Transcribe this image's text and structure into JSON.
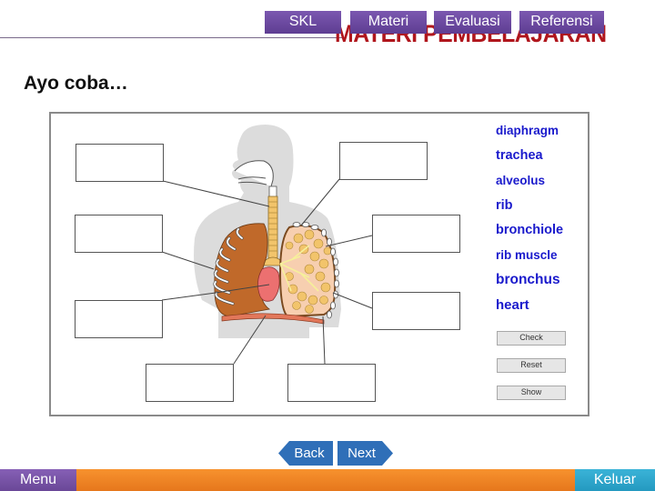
{
  "header": {
    "title": "MATERI PEMBELAJARAN",
    "nav": [
      {
        "label": "SKL"
      },
      {
        "label": "Materi"
      },
      {
        "label": "Evaluasi"
      },
      {
        "label": "Referensi"
      }
    ]
  },
  "main": {
    "heading": "Ayo coba…",
    "exercise": {
      "diagram_subject": "human respiratory system",
      "answer_boxes_count": 8,
      "word_bank": [
        {
          "label": "diaphragm"
        },
        {
          "label": "trachea"
        },
        {
          "label": "alveolus"
        },
        {
          "label": "rib"
        },
        {
          "label": "bronchiole"
        },
        {
          "label": "rib muscle"
        },
        {
          "label": "bronchus"
        },
        {
          "label": "heart"
        }
      ],
      "controls": {
        "check": "Check",
        "reset": "Reset",
        "show": "Show"
      }
    }
  },
  "navigation": {
    "back": "Back",
    "next": "Next"
  },
  "footer": {
    "menu": "Menu",
    "exit": "Keluar"
  },
  "colors": {
    "nav_purple": "#6a4797",
    "title_red": "#b0161d",
    "word_blue": "#1a1acc",
    "nav_blue": "#2f6fb8",
    "footer_orange": "#f08a28",
    "exit_cyan": "#2ea6cc"
  }
}
